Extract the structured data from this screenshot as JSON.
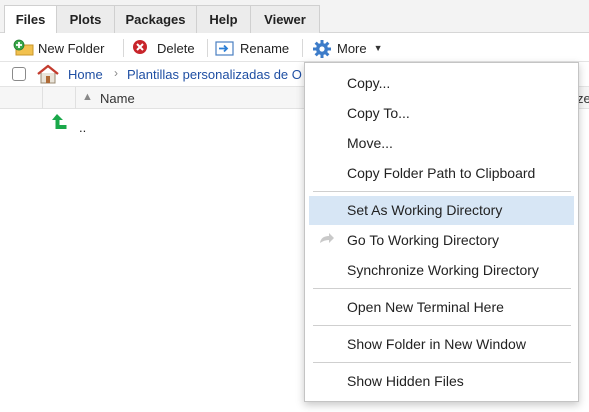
{
  "tabs": [
    {
      "label": "Files",
      "active": true
    },
    {
      "label": "Plots",
      "active": false
    },
    {
      "label": "Packages",
      "active": false
    },
    {
      "label": "Help",
      "active": false
    },
    {
      "label": "Viewer",
      "active": false
    }
  ],
  "toolbar": {
    "new_folder": "New Folder",
    "delete": "Delete",
    "rename": "Rename",
    "more": "More"
  },
  "breadcrumb": {
    "home": "Home",
    "folder": "Plantillas personalizadas de O"
  },
  "columns": {
    "name": "Name",
    "size_partial": "ze"
  },
  "files": [
    {
      "name": ".."
    }
  ],
  "menu": {
    "items": [
      "Copy...",
      "Copy To...",
      "Move...",
      "Copy Folder Path to Clipboard",
      "Set As Working Directory",
      "Go To Working Directory",
      "Synchronize Working Directory",
      "Open New Terminal Here",
      "Show Folder in New Window",
      "Show Hidden Files"
    ],
    "highlighted": "Set As Working Directory"
  },
  "colors": {
    "link": "#1f4fa3",
    "menu_highlight": "#d7e6f5",
    "up_arrow": "#1aa84a",
    "delete_red": "#c8252b"
  }
}
